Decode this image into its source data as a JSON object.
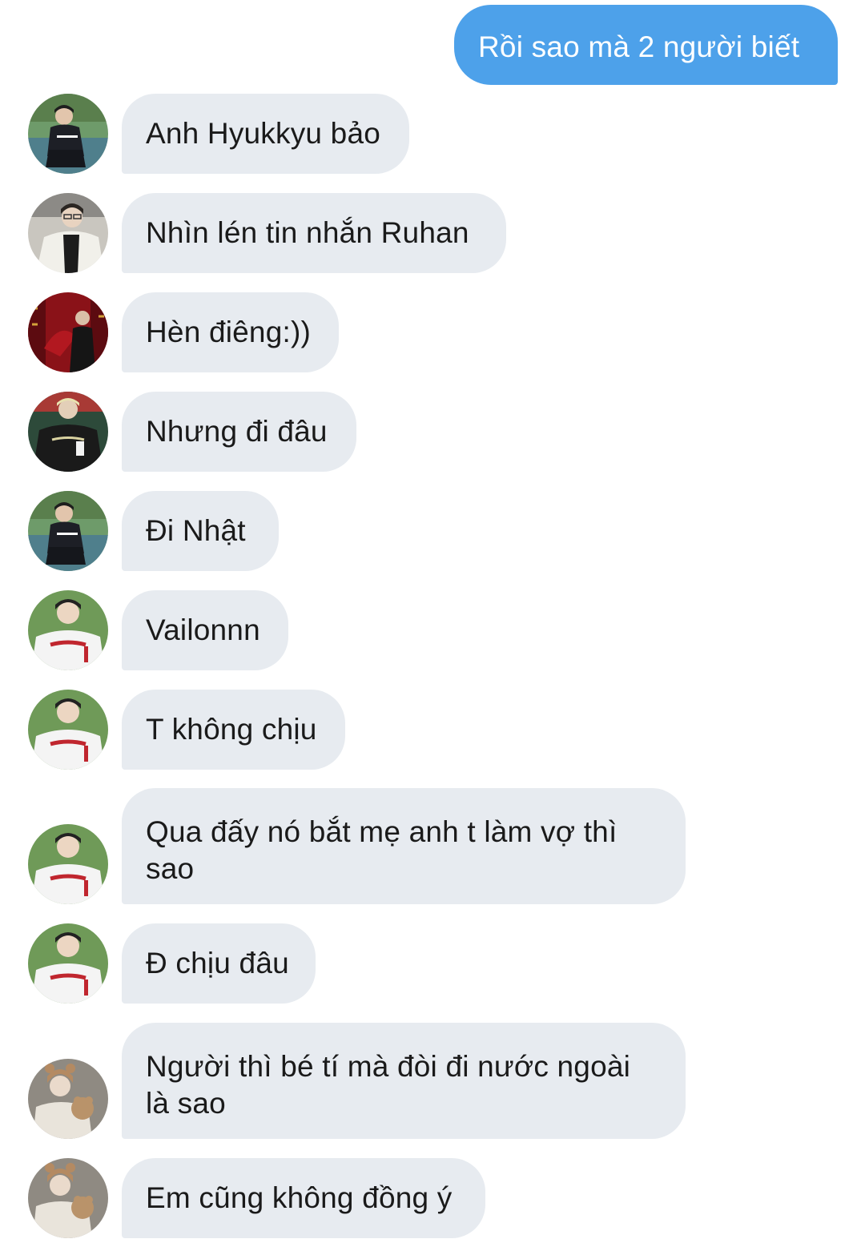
{
  "outgoing": {
    "text": "Rồi sao mà 2 người biết",
    "color": "#4da1ea"
  },
  "messages": [
    {
      "avatar": "avatar-sitting-court",
      "text": "Anh Hyukkyu bảo"
    },
    {
      "avatar": "avatar-glasses-white-jacket",
      "text": "Nhìn lén tin nhắn Ruhan"
    },
    {
      "avatar": "avatar-red-fan",
      "text": "Hèn điêng:))"
    },
    {
      "avatar": "avatar-blonde-jersey",
      "text": "Nhưng đi đâu"
    },
    {
      "avatar": "avatar-sitting-court",
      "text": "Đi Nhật"
    },
    {
      "avatar": "avatar-baseball-jersey",
      "text": "Vailonnn"
    },
    {
      "avatar": "avatar-baseball-jersey",
      "text": "T không chịu"
    },
    {
      "avatar": "avatar-baseball-jersey",
      "text": "Qua đấy nó bắt mẹ anh t làm vợ thì sao"
    },
    {
      "avatar": "avatar-baseball-jersey",
      "text": "Đ chịu đâu"
    },
    {
      "avatar": "avatar-teddy-hat",
      "text": "Người thì bé tí mà đòi đi nước ngoài là sao"
    },
    {
      "avatar": "avatar-teddy-hat",
      "text": "Em cũng không đồng ý"
    }
  ],
  "colors": {
    "incoming_bubble": "#e7ebf0",
    "incoming_text": "#1a1a1a",
    "background": "#ffffff"
  }
}
